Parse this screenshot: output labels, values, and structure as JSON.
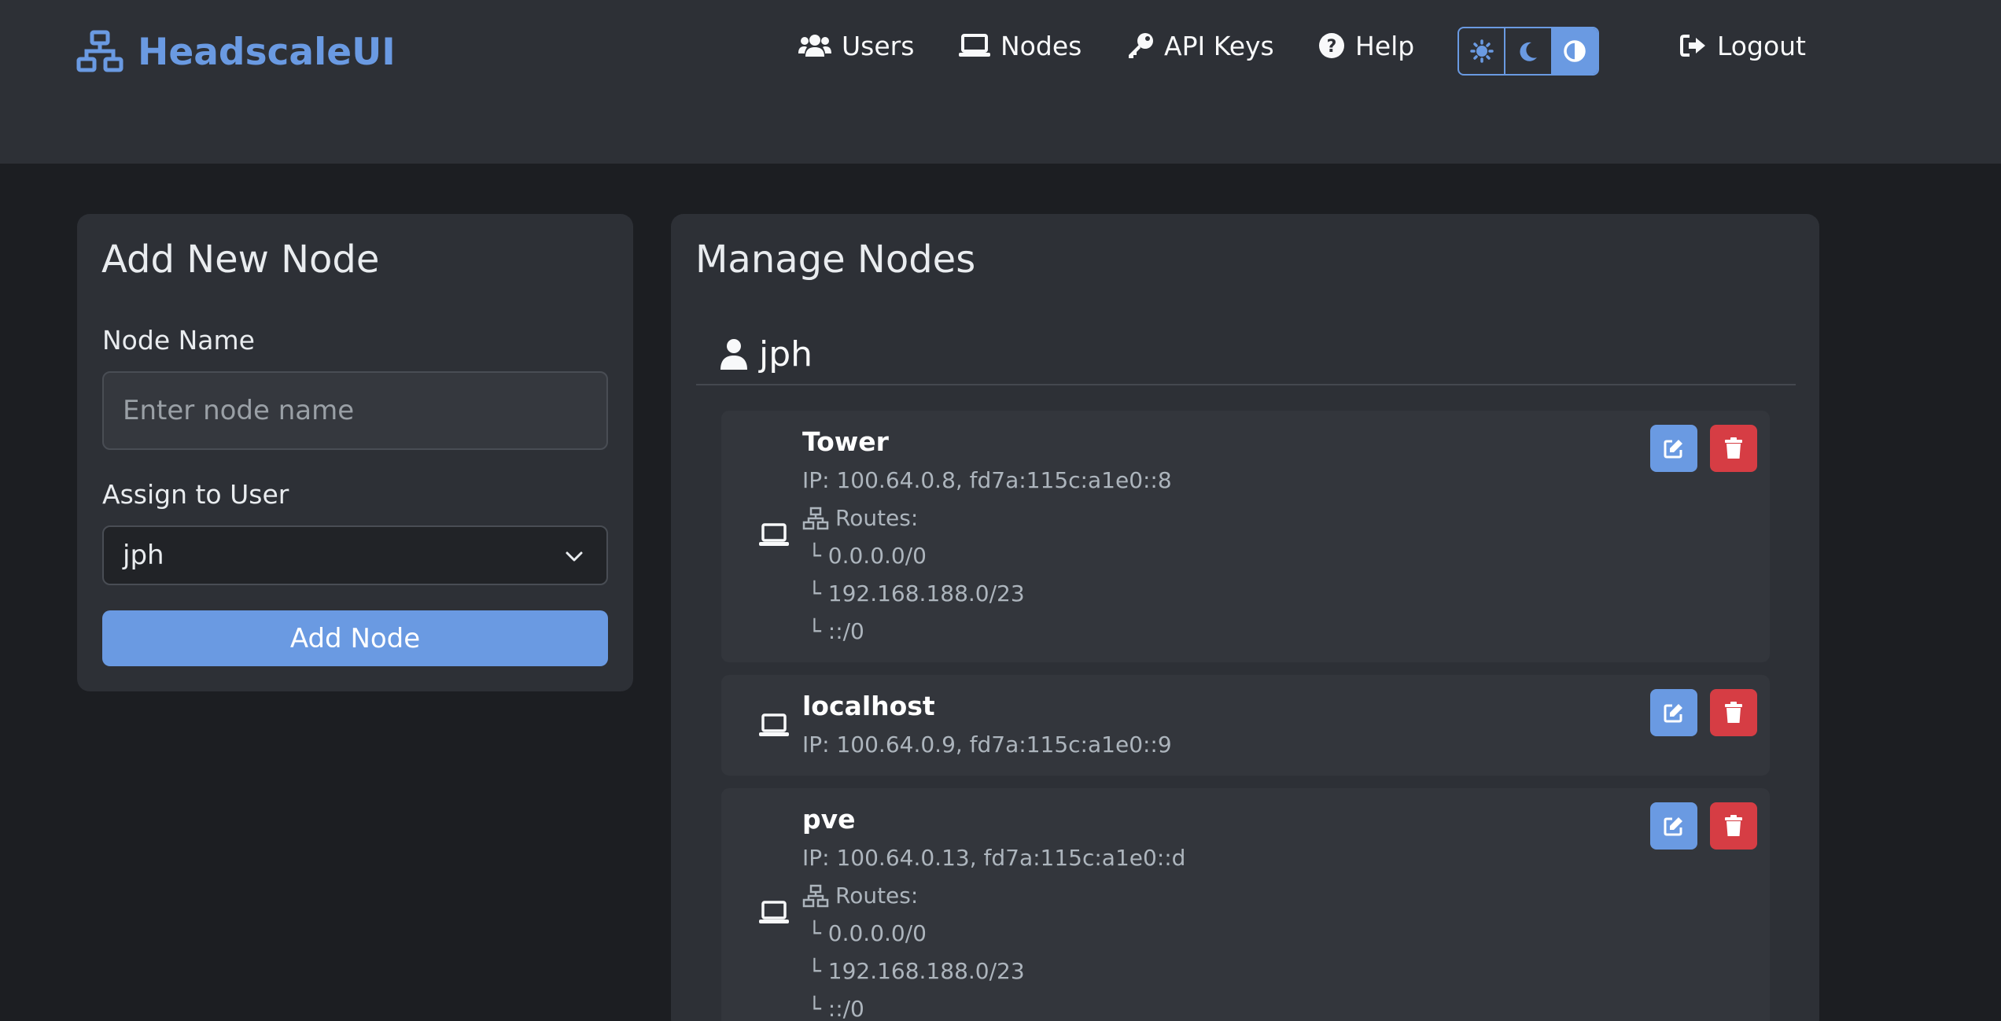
{
  "app": {
    "brand": "HeadscaleUI"
  },
  "nav": {
    "users": "Users",
    "nodes": "Nodes",
    "api_keys": "API Keys",
    "help": "Help",
    "logout": "Logout"
  },
  "theme": {
    "options": [
      "light",
      "dark",
      "auto"
    ],
    "active": "auto"
  },
  "add_node": {
    "title": "Add New Node",
    "name_label": "Node Name",
    "name_placeholder": "Enter node name",
    "user_label": "Assign to User",
    "user_selected": "jph",
    "submit": "Add Node"
  },
  "manage": {
    "title": "Manage Nodes",
    "user": "jph",
    "nodes": [
      {
        "name": "Tower",
        "ip": "IP: 100.64.0.8, fd7a:115c:a1e0::8",
        "routes_label": "Routes:",
        "routes": [
          "└ 0.0.0.0/0",
          "└ 192.168.188.0/23",
          "└ ::/0"
        ]
      },
      {
        "name": "localhost",
        "ip": "IP: 100.64.0.9, fd7a:115c:a1e0::9"
      },
      {
        "name": "pve",
        "ip": "IP: 100.64.0.13, fd7a:115c:a1e0::d",
        "routes_label": "Routes:",
        "routes": [
          "└ 0.0.0.0/0",
          "└ 192.168.188.0/23",
          "└ ::/0"
        ]
      }
    ]
  },
  "colors": {
    "accent": "#6a9ae2",
    "danger": "#d63d44",
    "navbar_bg": "#2d3036",
    "page_bg": "#1c1e22"
  }
}
